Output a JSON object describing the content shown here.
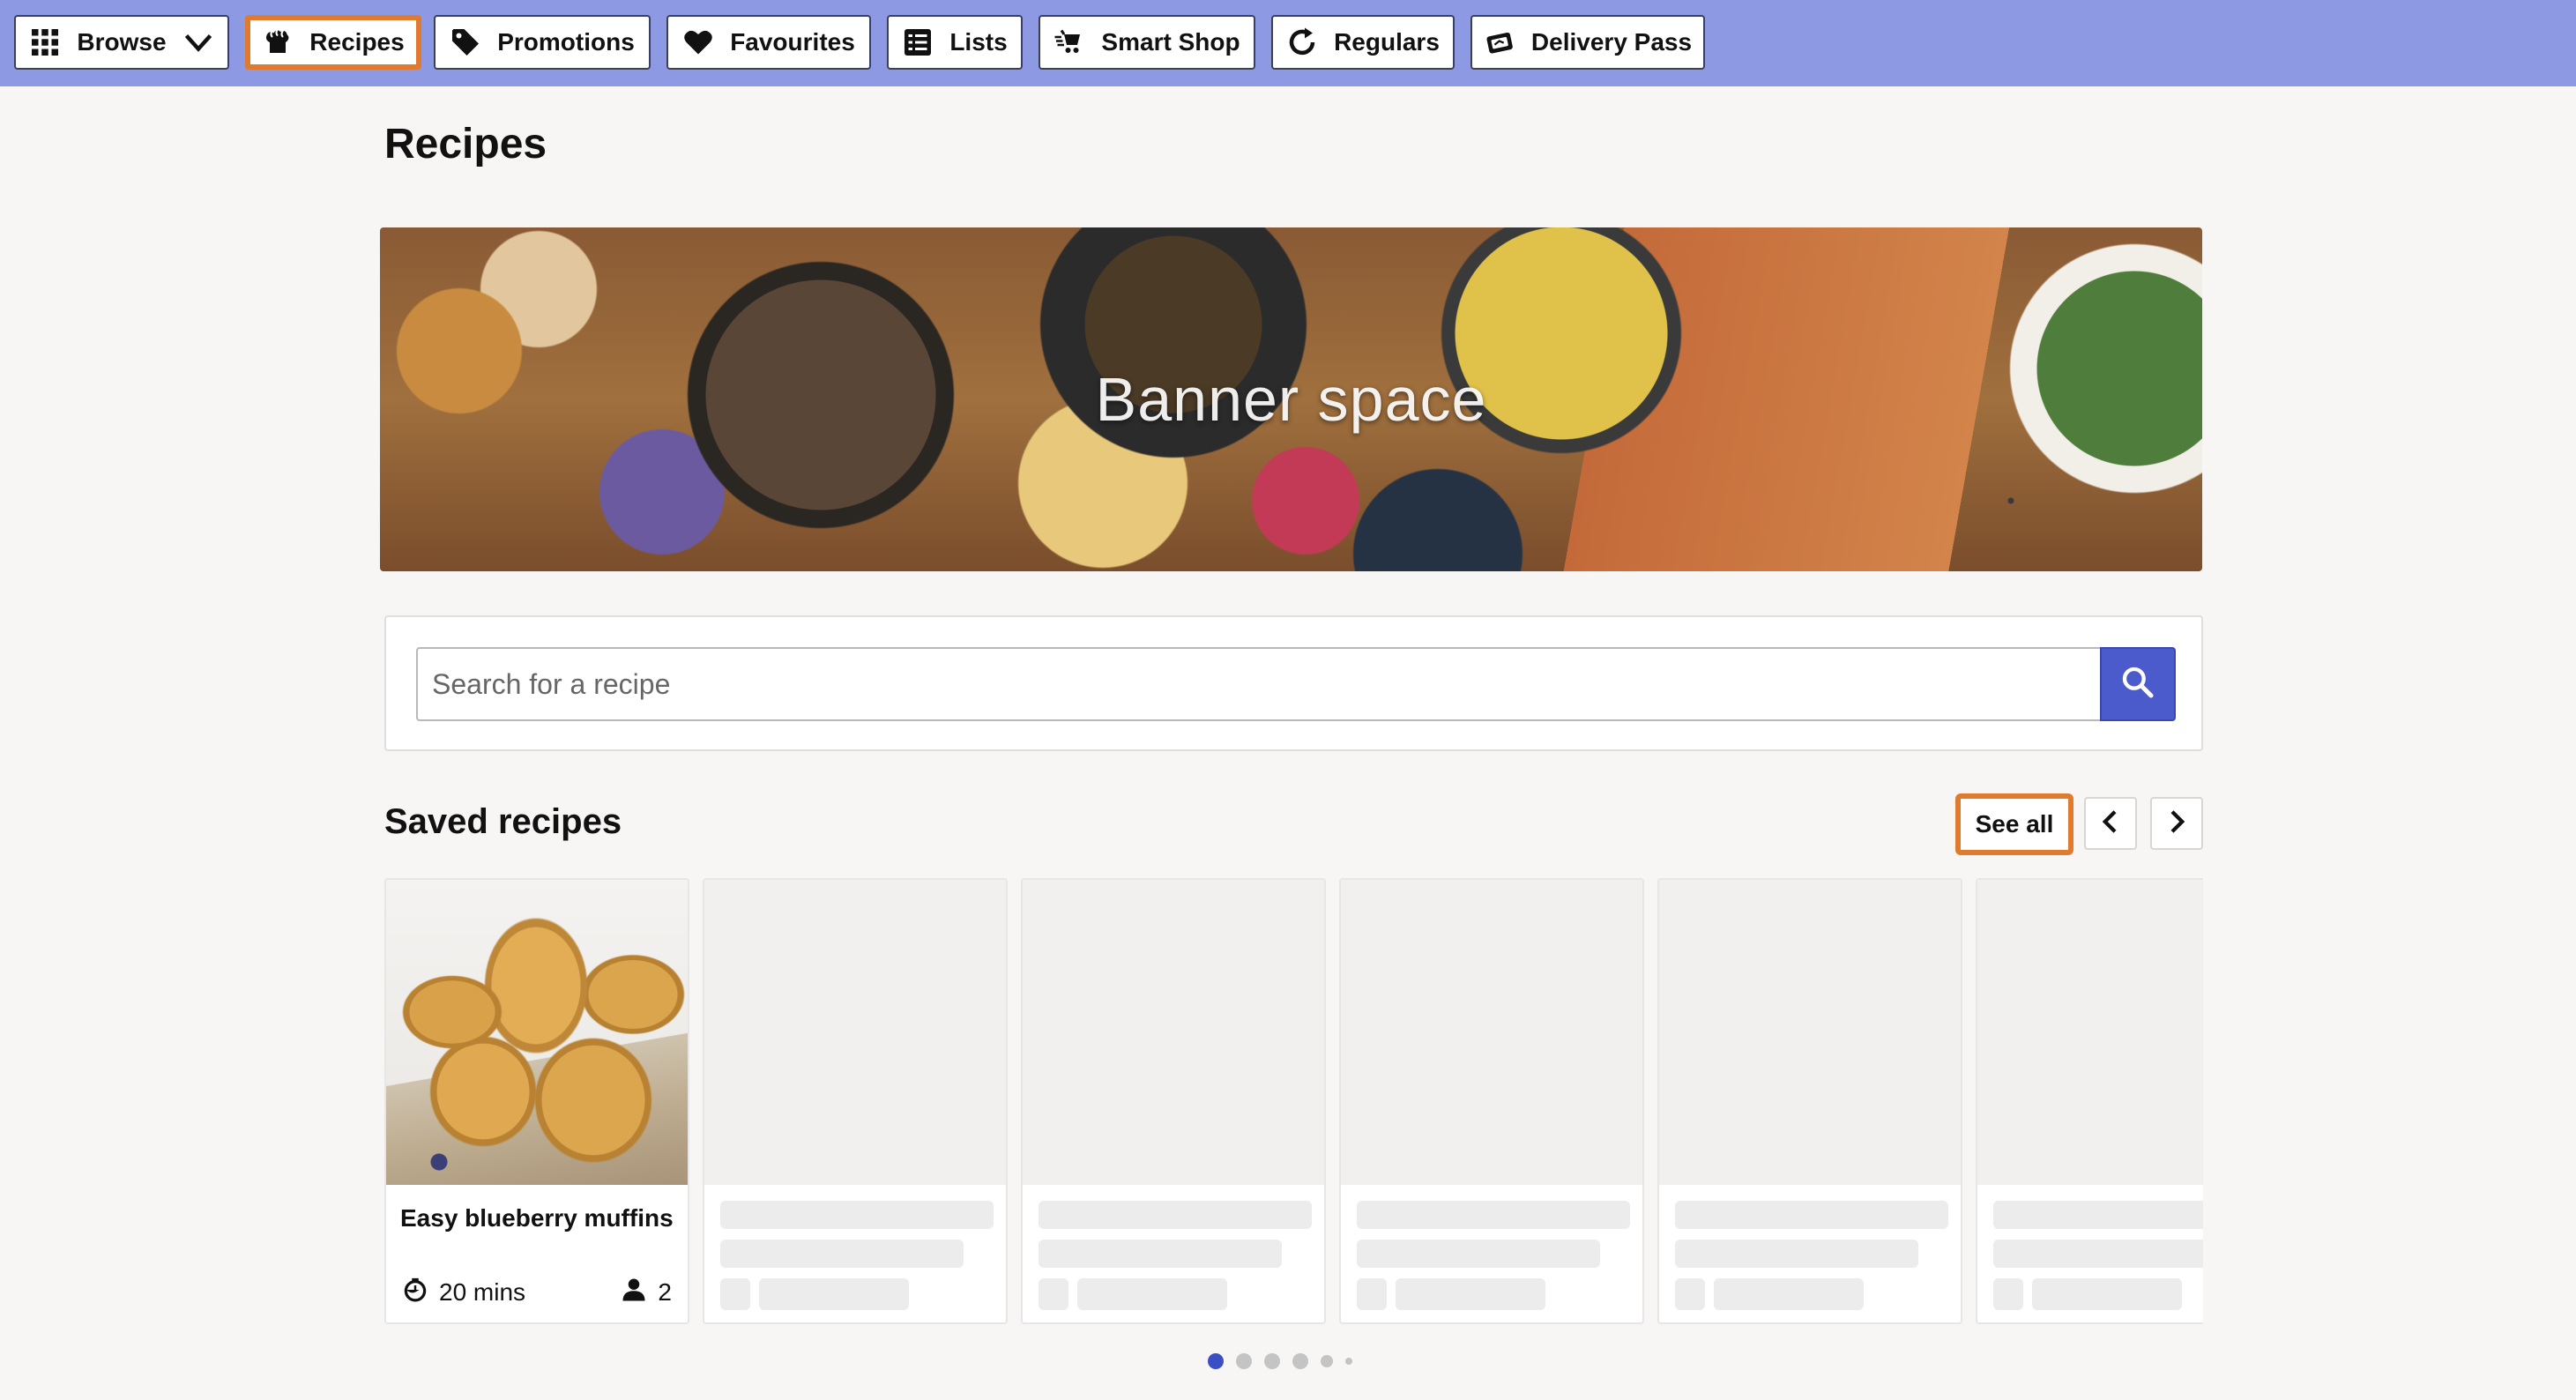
{
  "nav": {
    "browse": "Browse",
    "recipes": "Recipes",
    "promotions": "Promotions",
    "favourites": "Favourites",
    "lists": "Lists",
    "smart_shop": "Smart Shop",
    "regulars": "Regulars",
    "delivery_pass": "Delivery Pass",
    "active": "Recipes"
  },
  "page": {
    "title": "Recipes"
  },
  "banner": {
    "text": "Banner space"
  },
  "search": {
    "placeholder": "Search for a recipe",
    "value": ""
  },
  "saved": {
    "title": "Saved recipes",
    "see_all": "See all",
    "cards": [
      {
        "title": "Easy blueberry muffins",
        "time": "20 mins",
        "serves": "2",
        "loaded": true
      },
      {
        "loaded": false
      },
      {
        "loaded": false
      },
      {
        "loaded": false
      },
      {
        "loaded": false
      },
      {
        "loaded": false
      }
    ],
    "pagination": {
      "pages": 6,
      "current": 1
    }
  },
  "colors": {
    "nav_bg": "#8e99e3",
    "highlight": "#e07a2e",
    "search_button": "#4b5bcc",
    "active_dot": "#3b4fc4"
  },
  "icons": [
    "grid-icon",
    "chevron-down-icon",
    "chef-hat-icon",
    "tag-icon",
    "heart-icon",
    "list-icon",
    "smart-shop-icon",
    "refresh-icon",
    "delivery-pass-icon",
    "search-icon",
    "chevron-left-icon",
    "chevron-right-icon",
    "timer-icon",
    "person-icon"
  ]
}
